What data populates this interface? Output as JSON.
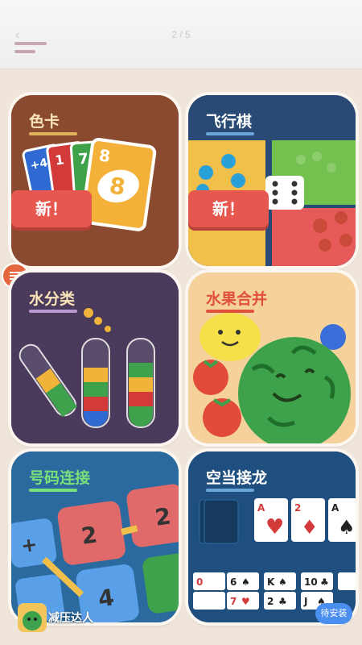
{
  "header": {
    "back_icon": "back-arrow-icon",
    "pager": "2 / 5",
    "menu_icon": "menu-lines-icon"
  },
  "cards": [
    {
      "title": "色卡",
      "badge": "新！"
    },
    {
      "title": "飞行棋",
      "badge": "新！"
    },
    {
      "title": "水分类"
    },
    {
      "title": "水果合并"
    },
    {
      "title": "号码连接",
      "tiles": [
        "2",
        "2",
        "4"
      ]
    },
    {
      "title": "空当接龙",
      "playing_cards_top": [
        "A",
        "2",
        "A"
      ],
      "playing_cards_bottom": [
        "0",
        "6",
        "K",
        "10"
      ],
      "playing_cards_row3": [
        "7",
        "2",
        "J"
      ]
    }
  ],
  "uno_cards": [
    "+4",
    "1",
    "7",
    "8",
    "8"
  ],
  "ad": {
    "name": "减压达人",
    "install": "待安装"
  },
  "colors": {
    "accent_red": "#e6584f",
    "install_blue": "#4a8ef0"
  }
}
